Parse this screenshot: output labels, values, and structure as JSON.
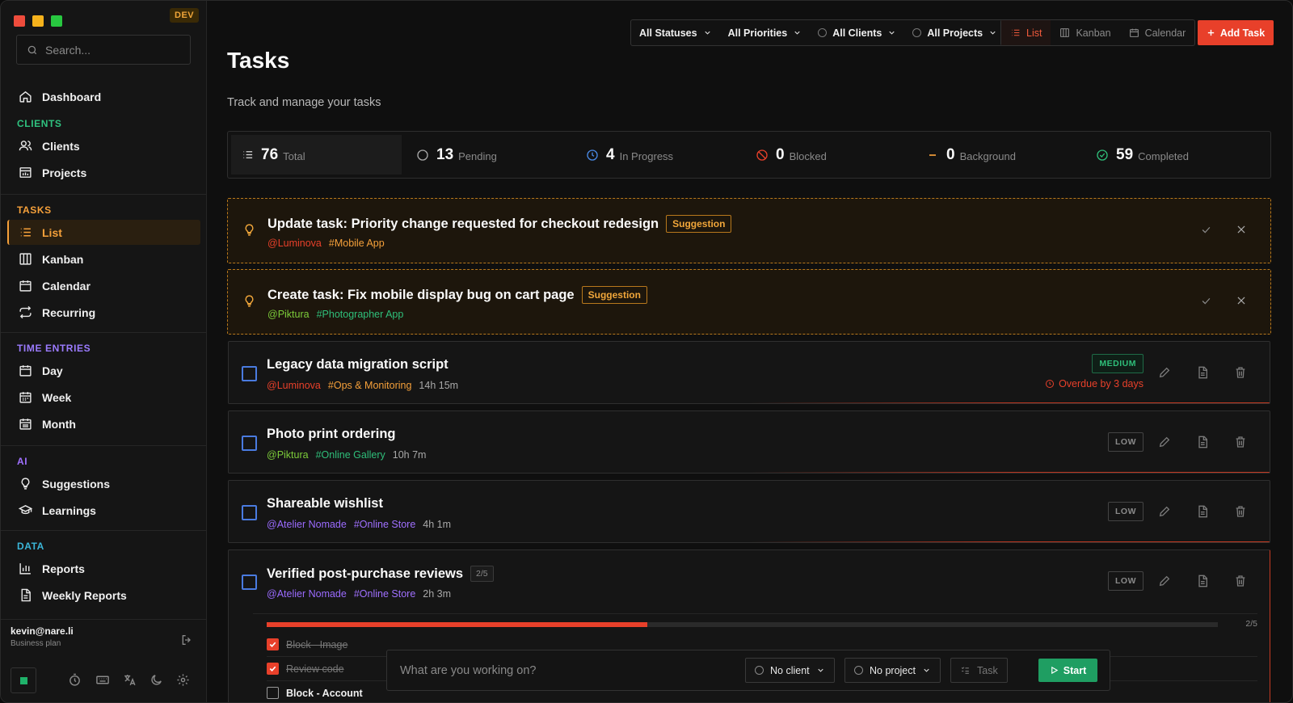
{
  "app": {
    "env_badge": "DEV"
  },
  "colors": {
    "accent": "#e8402a",
    "orange": "#f5a03a",
    "green": "#1fb26a",
    "purple": "#9b6bff",
    "cyan": "#3bb6d8"
  },
  "sidebar": {
    "search_placeholder": "Search...",
    "dashboard": "Dashboard",
    "sections": {
      "clients": "CLIENTS",
      "tasks": "TASKS",
      "time_entries": "TIME ENTRIES",
      "ai": "AI",
      "data": "DATA"
    },
    "items": {
      "clients": "Clients",
      "projects": "Projects",
      "list": "List",
      "kanban": "Kanban",
      "calendar": "Calendar",
      "recurring": "Recurring",
      "day": "Day",
      "week": "Week",
      "month": "Month",
      "suggestions": "Suggestions",
      "learnings": "Learnings",
      "reports": "Reports",
      "weekly_reports": "Weekly Reports"
    },
    "user": {
      "email": "kevin@nare.li",
      "plan": "Business plan"
    }
  },
  "toolbar": {
    "filters": [
      "All Statuses",
      "All Priorities",
      "All Clients",
      "All Projects"
    ],
    "views": [
      "List",
      "Kanban",
      "Calendar"
    ],
    "add_task": "Add Task"
  },
  "page": {
    "title": "Tasks",
    "subtitle": "Track and manage your tasks"
  },
  "stats": [
    {
      "value": "76",
      "label": "Total"
    },
    {
      "value": "13",
      "label": "Pending"
    },
    {
      "value": "4",
      "label": "In Progress"
    },
    {
      "value": "0",
      "label": "Blocked"
    },
    {
      "value": "0",
      "label": "Background"
    },
    {
      "value": "59",
      "label": "Completed"
    }
  ],
  "suggestions": [
    {
      "title": "Update task: Priority change requested for checkout redesign",
      "badge": "Suggestion",
      "client": "@Luminova",
      "project": "#Mobile App"
    },
    {
      "title": "Create task: Fix mobile display bug on cart page",
      "badge": "Suggestion",
      "client": "@Piktura",
      "project": "#Photographer App"
    }
  ],
  "tasks": [
    {
      "name": "Legacy data migration script",
      "client": "@Luminova",
      "project": "#Ops & Monitoring",
      "time": "14h 15m",
      "priority": "MEDIUM",
      "overdue": "Overdue by 3 days"
    },
    {
      "name": "Photo print ordering",
      "client": "@Piktura",
      "project": "#Online Gallery",
      "time": "10h 7m",
      "priority": "LOW"
    },
    {
      "name": "Shareable wishlist",
      "client": "@Atelier Nomade",
      "project": "#Online Store",
      "time": "4h 1m",
      "priority": "LOW"
    },
    {
      "name": "Verified post-purchase reviews",
      "subcount": "2/5",
      "client": "@Atelier Nomade",
      "project": "#Online Store",
      "time": "2h 3m",
      "priority": "LOW",
      "progress": 0.4,
      "progress_label": "2/5",
      "subtasks": [
        {
          "text": "Block - Image",
          "done": true
        },
        {
          "text": "Review code",
          "done": true
        },
        {
          "text": "Block - Account",
          "done": false
        }
      ]
    }
  ],
  "timer": {
    "placeholder": "What are you working on?",
    "client": "No client",
    "project": "No project",
    "task": "Task",
    "start": "Start"
  }
}
